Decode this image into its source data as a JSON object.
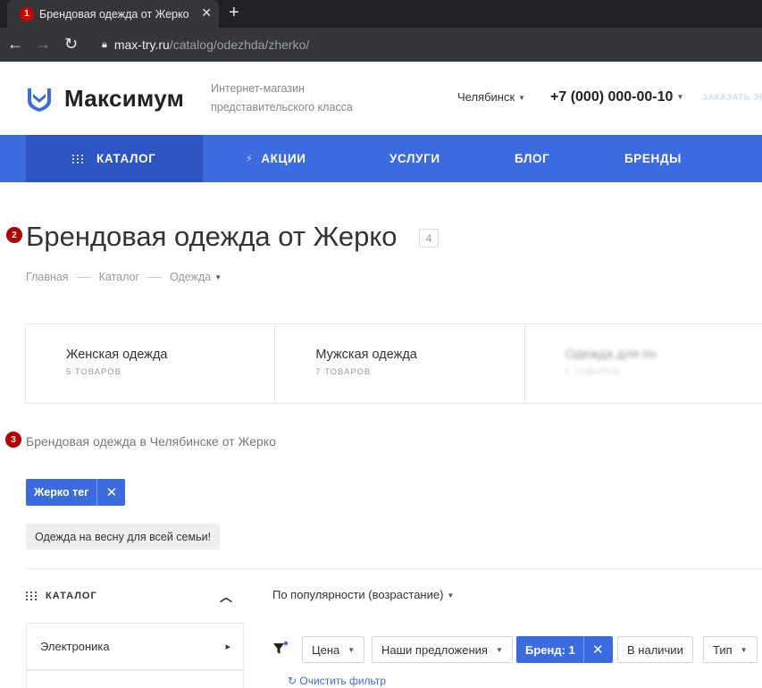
{
  "browser": {
    "tab_title": "Брендовая одежда от Жерко",
    "tab_marker": "1",
    "new_tab": "+",
    "url_host": "max-try.ru",
    "url_path": "/catalog/odezhda/zherko/"
  },
  "header": {
    "logo_text": "Максимум",
    "tagline_line1": "Интернет-магазин",
    "tagline_line2": "представительского класса",
    "city": "Челябинск",
    "phone": "+7 (000) 000-00-10",
    "callback": "ЗАКАЗАТЬ ЗВОНОК"
  },
  "nav": {
    "items": [
      {
        "label": "КАТАЛОГ"
      },
      {
        "label": "АКЦИИ"
      },
      {
        "label": "УСЛУГИ"
      },
      {
        "label": "БЛОГ"
      },
      {
        "label": "БРЕНДЫ"
      }
    ]
  },
  "page": {
    "title_marker": "2",
    "title": "Брендовая одежда от Жерко",
    "count": "4",
    "breadcrumb": [
      "Главная",
      "Каталог",
      "Одежда"
    ],
    "subtitle_marker": "3",
    "subtitle": "Брендовая одежда в Челябинске от Жерко"
  },
  "tiles": [
    {
      "name": "Женская одежда",
      "count": "5 ТОВАРОВ"
    },
    {
      "name": "Мужская одежда",
      "count": "7 ТОВАРОВ"
    },
    {
      "name": "Одежда для по",
      "count": "6 ТОВАРОВ"
    }
  ],
  "tags": {
    "active": "Жерко тег",
    "other": "Одежда на весну для всей семьи!"
  },
  "sidebar": {
    "header": "КАТАЛОГ",
    "items": [
      {
        "label": "Электроника"
      }
    ]
  },
  "sort": {
    "label": "По популярности (возрастание)"
  },
  "filters": {
    "price": "Цена",
    "offers": "Наши предложения",
    "brand": "Бренд: 1",
    "in_stock": "В наличии",
    "type": "Тип",
    "clear": "Очистить фильтр"
  },
  "colors": {
    "accent": "#3c6be0",
    "accent_dark": "#2c54c3",
    "marker": "#b00000"
  }
}
